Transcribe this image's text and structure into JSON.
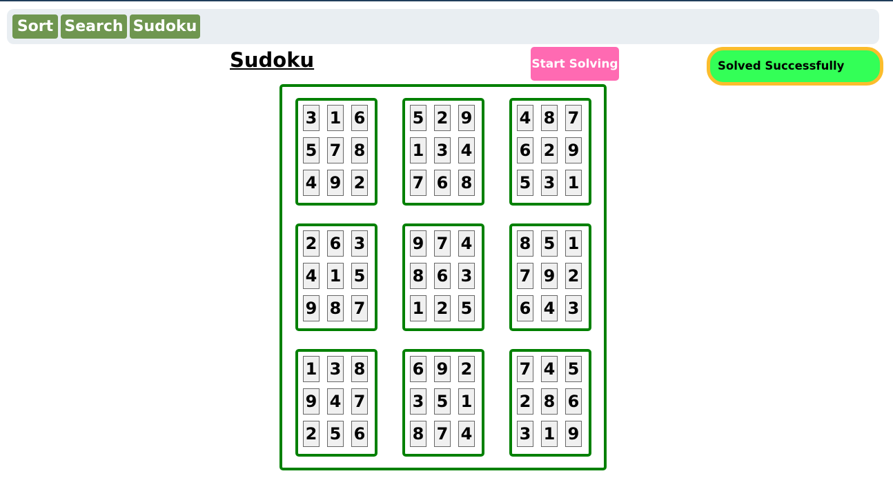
{
  "nav": {
    "items": [
      {
        "label": "Sort"
      },
      {
        "label": "Search"
      },
      {
        "label": "Sudoku"
      }
    ]
  },
  "main": {
    "title": "Sudoku",
    "start_button_label": "Start Solving",
    "status_text": "Solved Successfully"
  },
  "colors": {
    "nav_button": "#6f9650",
    "navbar_bg": "#e9eef2",
    "start_button": "#ff6ab2",
    "status_fill": "#33ff57",
    "status_border": "#fbbd2c",
    "grid_border": "#008000",
    "cell_bg": "#f0f0f0"
  },
  "sudoku": {
    "subgrids": [
      {
        "cells": [
          "3",
          "1",
          "6",
          "5",
          "7",
          "8",
          "4",
          "9",
          "2"
        ]
      },
      {
        "cells": [
          "5",
          "2",
          "9",
          "1",
          "3",
          "4",
          "7",
          "6",
          "8"
        ]
      },
      {
        "cells": [
          "4",
          "8",
          "7",
          "6",
          "2",
          "9",
          "5",
          "3",
          "1"
        ]
      },
      {
        "cells": [
          "2",
          "6",
          "3",
          "4",
          "1",
          "5",
          "9",
          "8",
          "7"
        ]
      },
      {
        "cells": [
          "9",
          "7",
          "4",
          "8",
          "6",
          "3",
          "1",
          "2",
          "5"
        ]
      },
      {
        "cells": [
          "8",
          "5",
          "1",
          "7",
          "9",
          "2",
          "6",
          "4",
          "3"
        ]
      },
      {
        "cells": [
          "1",
          "3",
          "8",
          "9",
          "4",
          "7",
          "2",
          "5",
          "6"
        ]
      },
      {
        "cells": [
          "6",
          "9",
          "2",
          "3",
          "5",
          "1",
          "8",
          "7",
          "4"
        ]
      },
      {
        "cells": [
          "7",
          "4",
          "5",
          "2",
          "8",
          "6",
          "3",
          "1",
          "9"
        ]
      }
    ]
  }
}
